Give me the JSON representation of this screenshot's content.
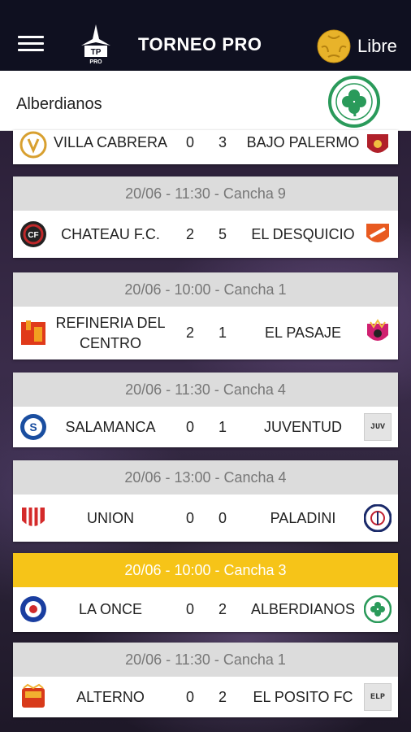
{
  "header": {
    "title": "TORNEO PRO",
    "logo_text": "TP",
    "logo_sub": "PRO",
    "libre_label": "Libre"
  },
  "team_bar": {
    "name": "Alberdianos"
  },
  "partial_match": {
    "home": "VILLA CABRERA",
    "home_score": "0",
    "away_score": "3",
    "away": "BAJO PALERMO"
  },
  "matches": [
    {
      "header": "20/06 - 11:30 - Cancha 9",
      "home": "CHATEAU F.C.",
      "home_score": "2",
      "away_score": "5",
      "away": "EL DESQUICIO"
    },
    {
      "header": "20/06 - 10:00 - Cancha 1",
      "home": "REFINERIA DEL CENTRO",
      "home_score": "2",
      "away_score": "1",
      "away": "EL PASAJE"
    },
    {
      "header": "20/06 - 11:30 - Cancha 4",
      "home": "SALAMANCA",
      "home_score": "0",
      "away_score": "1",
      "away": "JUVENTUD",
      "away_abbr": "JUV"
    },
    {
      "header": "20/06 - 13:00 - Cancha 4",
      "home": "UNION",
      "home_score": "0",
      "away_score": "0",
      "away": "PALADINI"
    },
    {
      "header": "20/06 - 10:00 - Cancha 3",
      "home": "LA ONCE",
      "home_score": "0",
      "away_score": "2",
      "away": "ALBERDIANOS"
    },
    {
      "header": "20/06 - 11:30 - Cancha 1",
      "home": "ALTERNO",
      "home_score": "0",
      "away_score": "2",
      "away": "EL POSITO FC",
      "away_abbr": "ELP"
    }
  ],
  "colors": {
    "header_bg": "#0f1020",
    "highlight": "#f6c418",
    "card_head": "#dcdcdc"
  }
}
